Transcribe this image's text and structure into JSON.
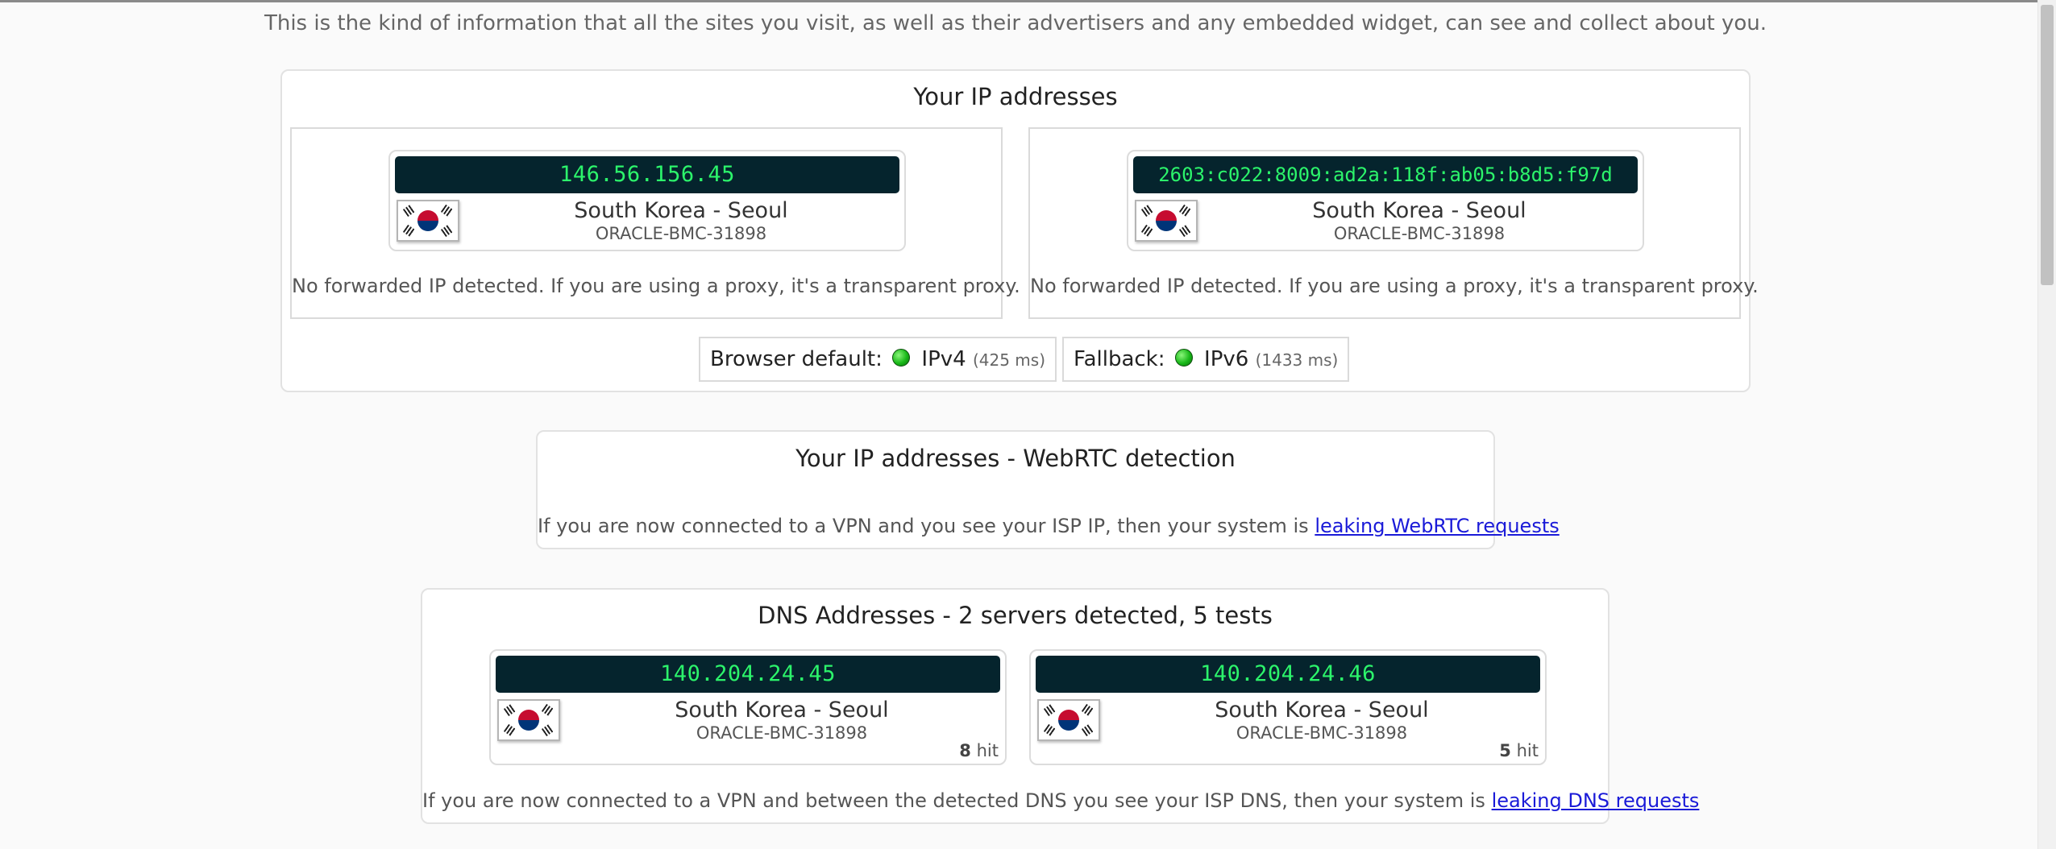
{
  "intro": "This is the kind of information that all the sites you visit, as well as their advertisers and any embedded widget, can see and collect about you.",
  "ip_panel": {
    "title": "Your IP addresses",
    "entries": [
      {
        "ip": "146.56.156.45",
        "location": "South Korea - Seoul",
        "isp": "ORACLE-BMC-31898",
        "flag": "south-korea-flag",
        "note": "No forwarded IP detected. If you are using a proxy, it's a transparent proxy."
      },
      {
        "ip": "2603:c022:8009:ad2a:118f:ab05:b8d5:f97d",
        "location": "South Korea - Seoul",
        "isp": "ORACLE-BMC-31898",
        "flag": "south-korea-flag",
        "note": "No forwarded IP detected. If you are using a proxy, it's a transparent proxy."
      }
    ],
    "browser_default": {
      "label": "Browser default:",
      "protocol": "IPv4",
      "latency": "(425 ms)",
      "status_color": "#1cbc1c"
    },
    "fallback": {
      "label": "Fallback:",
      "protocol": "IPv6",
      "latency": "(1433 ms)",
      "status_color": "#1cbc1c"
    }
  },
  "webrtc_panel": {
    "title": "Your IP addresses - WebRTC detection",
    "note": "If you are now connected to a VPN and you see your ISP IP, then your system is",
    "link": "leaking WebRTC requests"
  },
  "dns_panel": {
    "title": "DNS Addresses - 2 servers detected, 5 tests",
    "entries": [
      {
        "ip": "140.204.24.45",
        "location": "South Korea - Seoul",
        "isp": "ORACLE-BMC-31898",
        "hits": "8",
        "hit_label": "hit",
        "flag": "south-korea-flag"
      },
      {
        "ip": "140.204.24.46",
        "location": "South Korea - Seoul",
        "isp": "ORACLE-BMC-31898",
        "hits": "5",
        "hit_label": "hit",
        "flag": "south-korea-flag"
      }
    ],
    "note": "If you are now connected to a VPN and between the detected DNS you see your ISP DNS, then your system is",
    "link": "leaking DNS requests"
  },
  "colors": {
    "ip_bar_bg": "#05242d",
    "ip_text": "#2cf46b",
    "link": "#1a1ad8"
  }
}
